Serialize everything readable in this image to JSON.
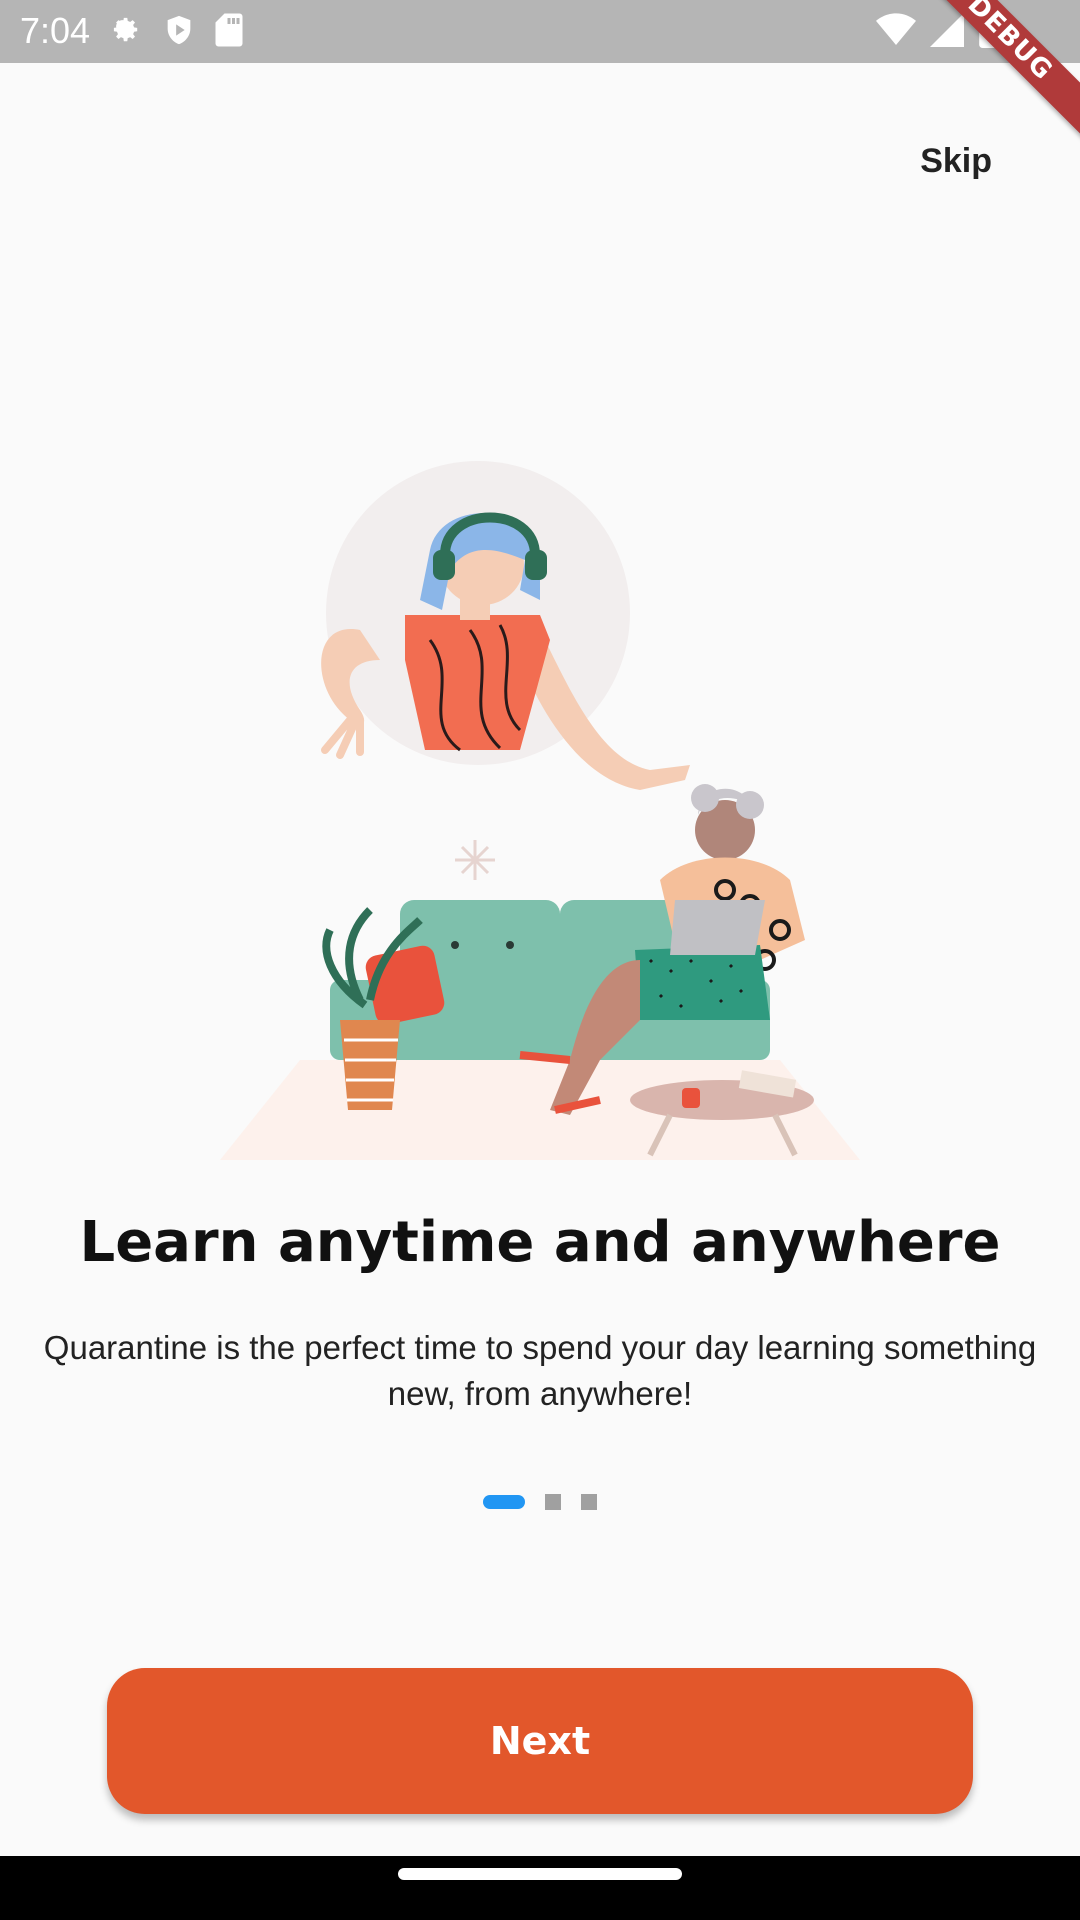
{
  "status_bar": {
    "time": "7:04",
    "icons_left": [
      "gear-icon",
      "shield-icon",
      "sd-card-icon"
    ],
    "icons_right": [
      "wifi-icon",
      "signal-icon",
      "battery-icon"
    ],
    "debug_label": "DEBUG"
  },
  "header": {
    "skip_label": "Skip"
  },
  "content": {
    "title": "Learn anytime and anywhere",
    "subtitle": "Quarantine is the perfect time to spend your day learning something new, from anywhere!"
  },
  "pager": {
    "page_count": 3,
    "active_index": 0
  },
  "actions": {
    "next_label": "Next"
  },
  "colors": {
    "primary": "#e2572b",
    "indicator_active": "#2196f3",
    "indicator_inactive": "#a0a0a0",
    "background": "#fafafa"
  }
}
